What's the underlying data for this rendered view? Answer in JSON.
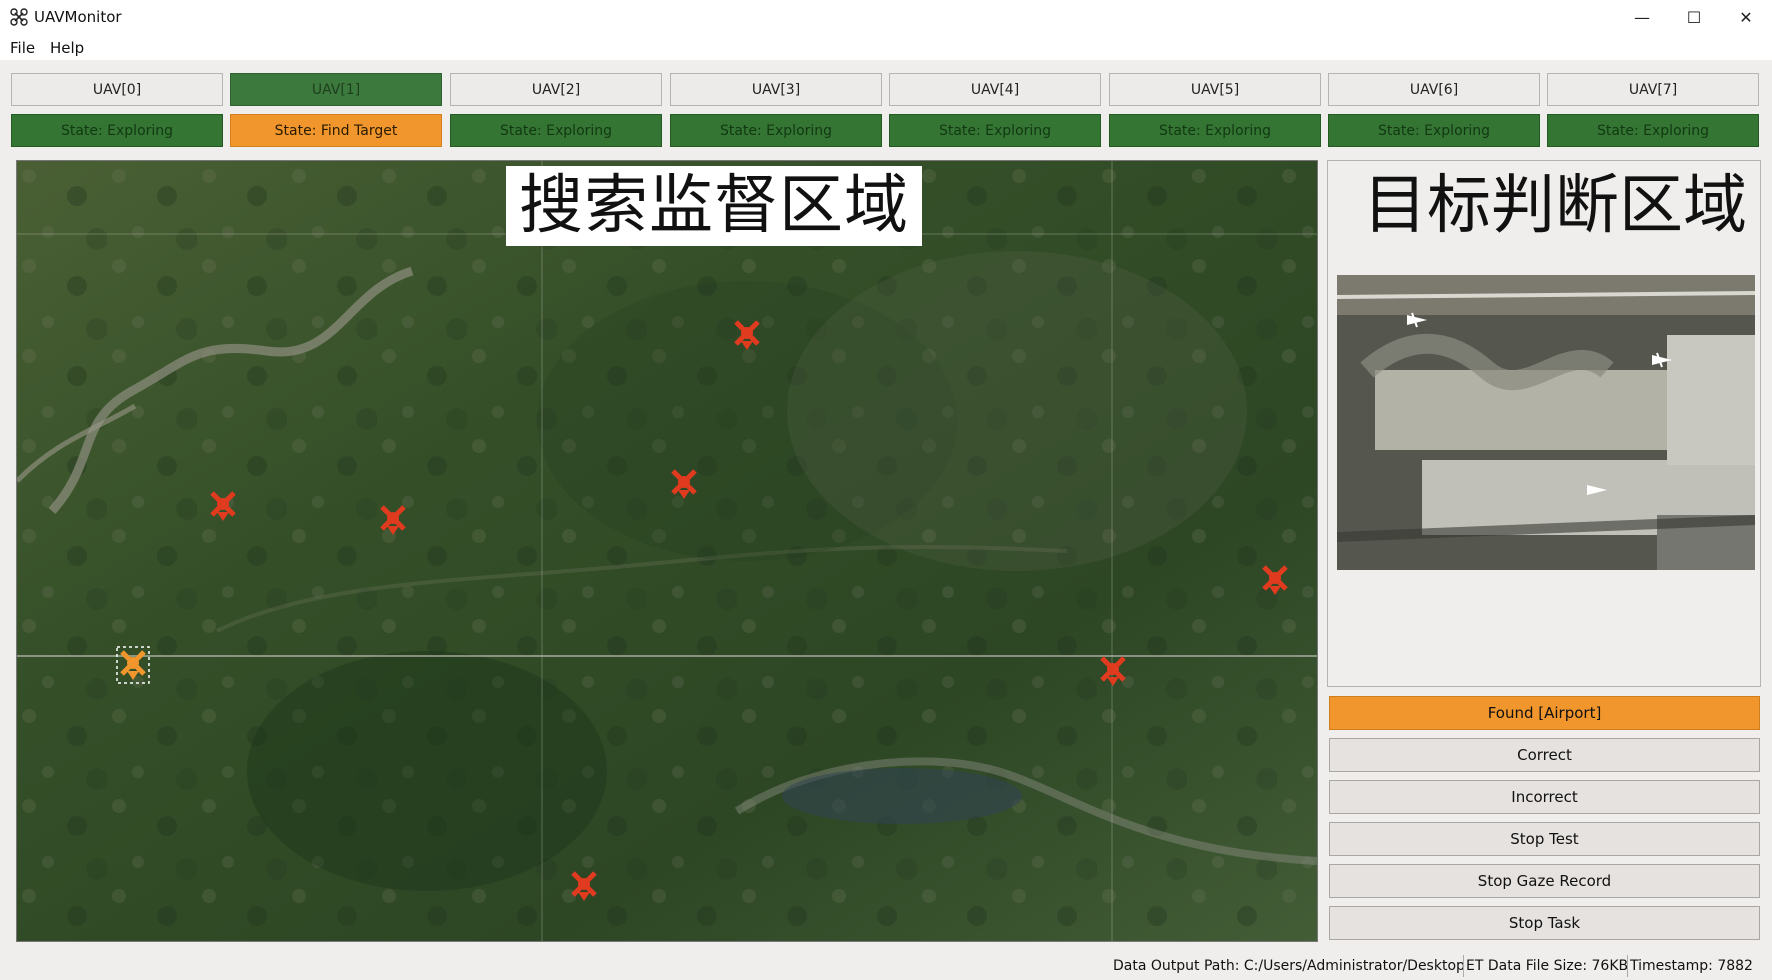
{
  "window": {
    "title": "UAVMonitor",
    "app_icon": "drone-icon",
    "controls": [
      "minimize-icon",
      "maximize-icon",
      "close-icon"
    ]
  },
  "menu": {
    "file": "File",
    "help": "Help"
  },
  "uav_tabs": [
    {
      "label": "UAV[0]",
      "state": "State: Exploring",
      "active": false
    },
    {
      "label": "UAV[1]",
      "state": "State: Find Target",
      "active": true
    },
    {
      "label": "UAV[2]",
      "state": "State: Exploring",
      "active": false
    },
    {
      "label": "UAV[3]",
      "state": "State: Exploring",
      "active": false
    },
    {
      "label": "UAV[4]",
      "state": "State: Exploring",
      "active": false
    },
    {
      "label": "UAV[5]",
      "state": "State: Exploring",
      "active": false
    },
    {
      "label": "UAV[6]",
      "state": "State: Exploring",
      "active": false
    },
    {
      "label": "UAV[7]",
      "state": "State: Exploring",
      "active": false
    }
  ],
  "map": {
    "zone_label": "搜索监督区域"
  },
  "judgement": {
    "zone_label": "目标判断区域"
  },
  "actions": {
    "found": "Found [Airport]",
    "correct": "Correct",
    "incorrect": "Incorrect",
    "stop_test": "Stop Test",
    "stop_gaze": "Stop Gaze Record",
    "stop_task": "Stop Task"
  },
  "status": {
    "output_path": "Data Output Path: C:/Users/Administrator/Desktop",
    "file_size": "ET Data File Size: 76KB",
    "timestamp": "Timestamp: 7882"
  },
  "colors": {
    "exploring": "#347533",
    "find_target": "#f0962d",
    "uav_marker": "#e03a1f"
  }
}
